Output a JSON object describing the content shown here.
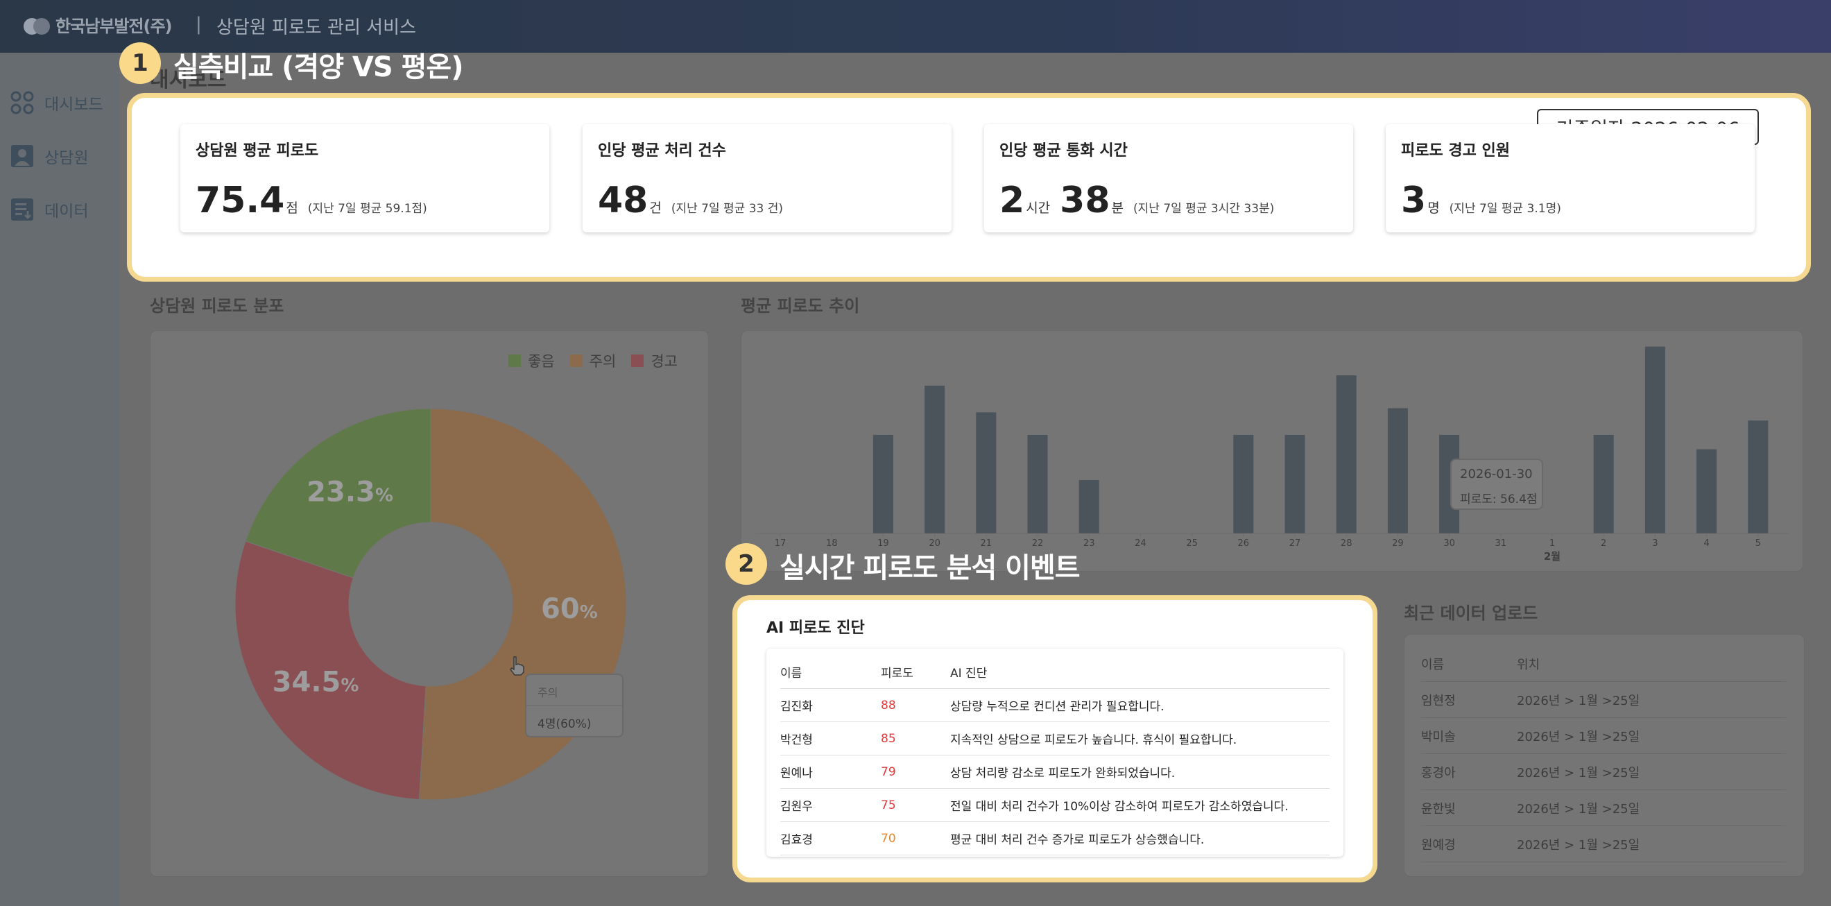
{
  "header": {
    "logo_text": "한국남부발전(주)",
    "separator": "|",
    "app_title": "상담원 피로도 관리 서비스"
  },
  "sidebar": {
    "items": [
      {
        "label": "대시보드",
        "icon": "dashboard-grid-icon"
      },
      {
        "label": "상담원",
        "icon": "person-icon"
      },
      {
        "label": "데이터",
        "icon": "data-list-icon"
      }
    ]
  },
  "page_title": "대시보드",
  "callouts": [
    {
      "number": "1",
      "label": "실측비교 (격양 VS 평온)"
    },
    {
      "number": "2",
      "label": "실시간 피로도 분석 이벤트"
    }
  ],
  "summary": {
    "base_date": "기준일자 2026-02-06",
    "kpis": [
      {
        "title": "상담원 평균 피로도",
        "parts": [
          {
            "num": "75.4",
            "unit": "점"
          }
        ],
        "note": "(지난 7일 평균 59.1점)"
      },
      {
        "title": "인당 평균 처리 건수",
        "parts": [
          {
            "num": "48",
            "unit": "건"
          }
        ],
        "note": "(지난 7일 평균 33 건)"
      },
      {
        "title": "인당 평균 통화 시간",
        "parts": [
          {
            "num": "2",
            "unit": "시간"
          },
          {
            "num": "38",
            "unit": "분"
          }
        ],
        "note": "(지난 7일 평균 3시간 33분)"
      },
      {
        "title": "피로도 경고 인원",
        "parts": [
          {
            "num": "3",
            "unit": "명"
          }
        ],
        "note": "(지난 7일 평균 3.1명)"
      }
    ]
  },
  "distribution": {
    "title": "상담원 피로도 분포",
    "tooltip": {
      "label": "주의",
      "value": "4명(60%)"
    }
  },
  "trend": {
    "title": "평균 피로도 추이",
    "tooltip": {
      "date": "2026-01-30",
      "value": "피로도: 56.4점"
    }
  },
  "ai_diagnosis": {
    "title": "AI 피로도 진단",
    "columns": [
      "이름",
      "피로도",
      "AI 진단"
    ],
    "rows": [
      {
        "name": "김진화",
        "score": "88",
        "diag": "상담량 누적으로 컨디션 관리가 필요합니다."
      },
      {
        "name": "박건형",
        "score": "85",
        "diag": "지속적인 상담으로 피로도가 높습니다. 휴식이 필요합니다."
      },
      {
        "name": "원예나",
        "score": "79",
        "diag": "상담 처리량 감소로 피로도가 완화되었습니다."
      },
      {
        "name": "김원우",
        "score": "75",
        "diag": "전일 대비 처리 건수가 10%이상 감소하여 피로도가 감소하였습니다."
      },
      {
        "name": "김효경",
        "score": "70",
        "diag": "평균 대비 처리 건수 증가로 피로도가 상승했습니다."
      }
    ],
    "score_colors": {
      "high": "#e0393a",
      "mid": "#e8872e"
    }
  },
  "uploads": {
    "title": "최근 데이터 업로드",
    "columns": [
      "이름",
      "위치"
    ],
    "rows": [
      {
        "name": "임현정",
        "loc": "2026년 > 1월 >25일"
      },
      {
        "name": "박미솔",
        "loc": "2026년 > 1월 >25일"
      },
      {
        "name": "홍경아",
        "loc": "2026년 > 1월 >25일"
      },
      {
        "name": "윤한빛",
        "loc": "2026년 > 1월 >25일"
      },
      {
        "name": "원예경",
        "loc": "2026년 > 1월 >25일"
      }
    ]
  },
  "chart_data": [
    {
      "type": "pie",
      "title": "상담원 피로도 분포",
      "donut": true,
      "series": [
        {
          "name": "좋음",
          "value": 23.3,
          "label": "23.3",
          "unit": "%",
          "color": "#5f7a48"
        },
        {
          "name": "주의",
          "value": 60,
          "label": "60",
          "unit": "%",
          "color": "#8c6a4c"
        },
        {
          "name": "경고",
          "value": 34.5,
          "label": "34.5",
          "unit": "%",
          "color": "#8a4f52"
        }
      ],
      "legend_position": "top-right"
    },
    {
      "type": "bar",
      "title": "평균 피로도 추이",
      "categories": [
        "17",
        "18",
        "19",
        "20",
        "21",
        "22",
        "23",
        "24",
        "25",
        "26",
        "27",
        "28",
        "29",
        "30",
        "31",
        "1",
        "2",
        "3",
        "4",
        "5"
      ],
      "month_label": {
        "after": "1",
        "text": "2월"
      },
      "values": [
        0,
        0,
        48,
        72,
        59,
        48,
        26,
        0,
        0,
        48,
        48,
        77,
        61,
        48,
        0,
        0,
        48,
        91,
        41,
        55
      ],
      "ylim": [
        0,
        100
      ],
      "color": "#4b535b",
      "grid": false
    }
  ]
}
